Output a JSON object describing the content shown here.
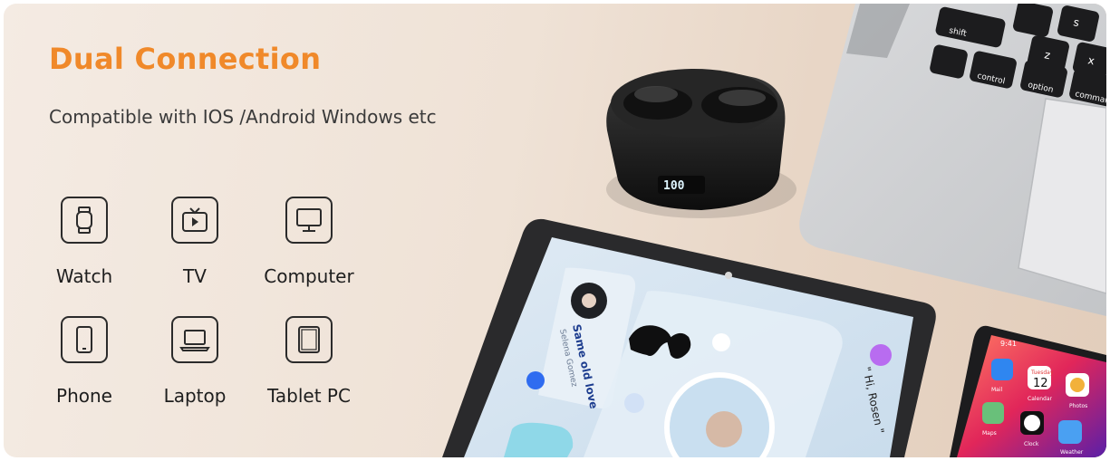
{
  "headline": "Dual Connection",
  "subline": "Compatible with IOS /Android Windows etc",
  "devices": [
    {
      "label": "Watch",
      "icon": "watch-icon"
    },
    {
      "label": "TV",
      "icon": "tv-icon"
    },
    {
      "label": "Computer",
      "icon": "computer-icon"
    },
    {
      "label": "Phone",
      "icon": "phone-icon"
    },
    {
      "label": "Laptop",
      "icon": "laptop-icon"
    },
    {
      "label": "Tablet PC",
      "icon": "tablet-icon"
    }
  ],
  "case_display": "100",
  "keyboard_keys": [
    "shift",
    "control",
    "option",
    "command",
    "z",
    "s",
    "x"
  ],
  "tablet_screen": {
    "song_title": "Same old love",
    "artist": "Selena Gomez",
    "greeting": "\" Hi, Rosen \""
  },
  "phone_screen": {
    "time": "9:41",
    "calendar_day": "Tuesday",
    "calendar_date": "12",
    "apps": [
      "Mail",
      "Calendar",
      "Photos",
      "Maps",
      "Clock",
      "Weather"
    ]
  },
  "colors": {
    "headline": "#f0892a",
    "text": "#3a3a3a",
    "background": "#efe2d6"
  }
}
